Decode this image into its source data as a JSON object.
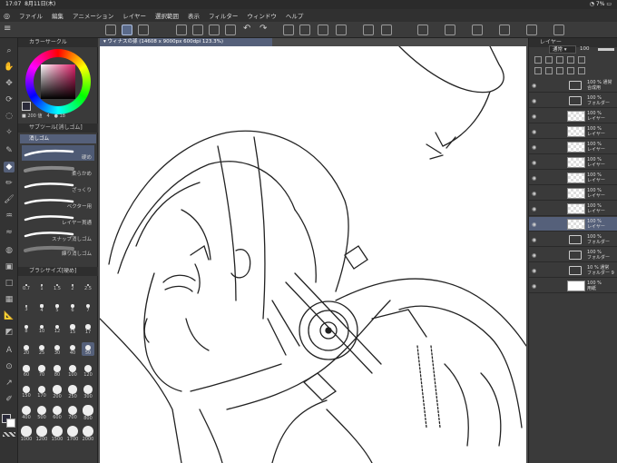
{
  "status": {
    "time": "17:07",
    "date": "8月11日(木)",
    "battery": "7%"
  },
  "menu": [
    "ファイル",
    "編集",
    "アニメーション",
    "レイヤー",
    "選択範囲",
    "表示",
    "フィルター",
    "ウィンドウ",
    "ヘルプ"
  ],
  "color_panel": {
    "title": "カラーサークル",
    "readout": "■ 200 値　4　● 18"
  },
  "subtool_panel": {
    "title": "サブツール[消しゴム]",
    "selected": "消しゴム",
    "items": [
      "硬め",
      "柔らかめ",
      "ざっくり",
      "ベクター用",
      "レイヤー貫通",
      "スナップ消しゴム",
      "練り消しゴム"
    ]
  },
  "brush_size_panel": {
    "title": "ブラシサイズ[硬め]",
    "sizes": [
      "0.7",
      "1",
      "1.5",
      "2",
      "2.5",
      "3",
      "4",
      "5",
      "6",
      "7",
      "8",
      "10",
      "12",
      "15",
      "17",
      "20",
      "25",
      "30",
      "40",
      "50",
      "60",
      "70",
      "80",
      "100",
      "120",
      "150",
      "170",
      "200",
      "250",
      "300",
      "400",
      "500",
      "600",
      "700",
      "800",
      "1000",
      "1200",
      "1500",
      "1700",
      "2000"
    ]
  },
  "document_tab": "ウィナスの孫 (14608 x 9000px 600dpi 123.3%)",
  "layer_panel": {
    "title": "レイヤー",
    "blend_mode": "通常",
    "opacity": "100",
    "layers": [
      {
        "label": "100 % 通常\n合成用",
        "kind": "folder"
      },
      {
        "label": "100 %\nフォルダー",
        "kind": "folder"
      },
      {
        "label": "100 %\nレイヤー",
        "kind": "layer"
      },
      {
        "label": "100 %\nレイヤー",
        "kind": "layer"
      },
      {
        "label": "100 %\nレイヤー",
        "kind": "layer"
      },
      {
        "label": "100 %\nレイヤー",
        "kind": "layer"
      },
      {
        "label": "100 %\nレイヤー",
        "kind": "layer"
      },
      {
        "label": "100 %\nレイヤー",
        "kind": "layer"
      },
      {
        "label": "100 %\nレイヤー",
        "kind": "layer"
      },
      {
        "label": "100 %\nレイヤー",
        "kind": "layer",
        "selected": true
      },
      {
        "label": "100 %\nフォルダー",
        "kind": "folder"
      },
      {
        "label": "100 %\nフォルダー",
        "kind": "folder"
      },
      {
        "label": "10 % 通常\nフォルダー 9",
        "kind": "folder"
      },
      {
        "label": "100 %\n用紙",
        "kind": "paper"
      }
    ]
  },
  "colors": {
    "accent": "#55607a",
    "panel": "#3a3a3a",
    "canvas": "#ffffff",
    "main_color": "#2a2a3a"
  }
}
